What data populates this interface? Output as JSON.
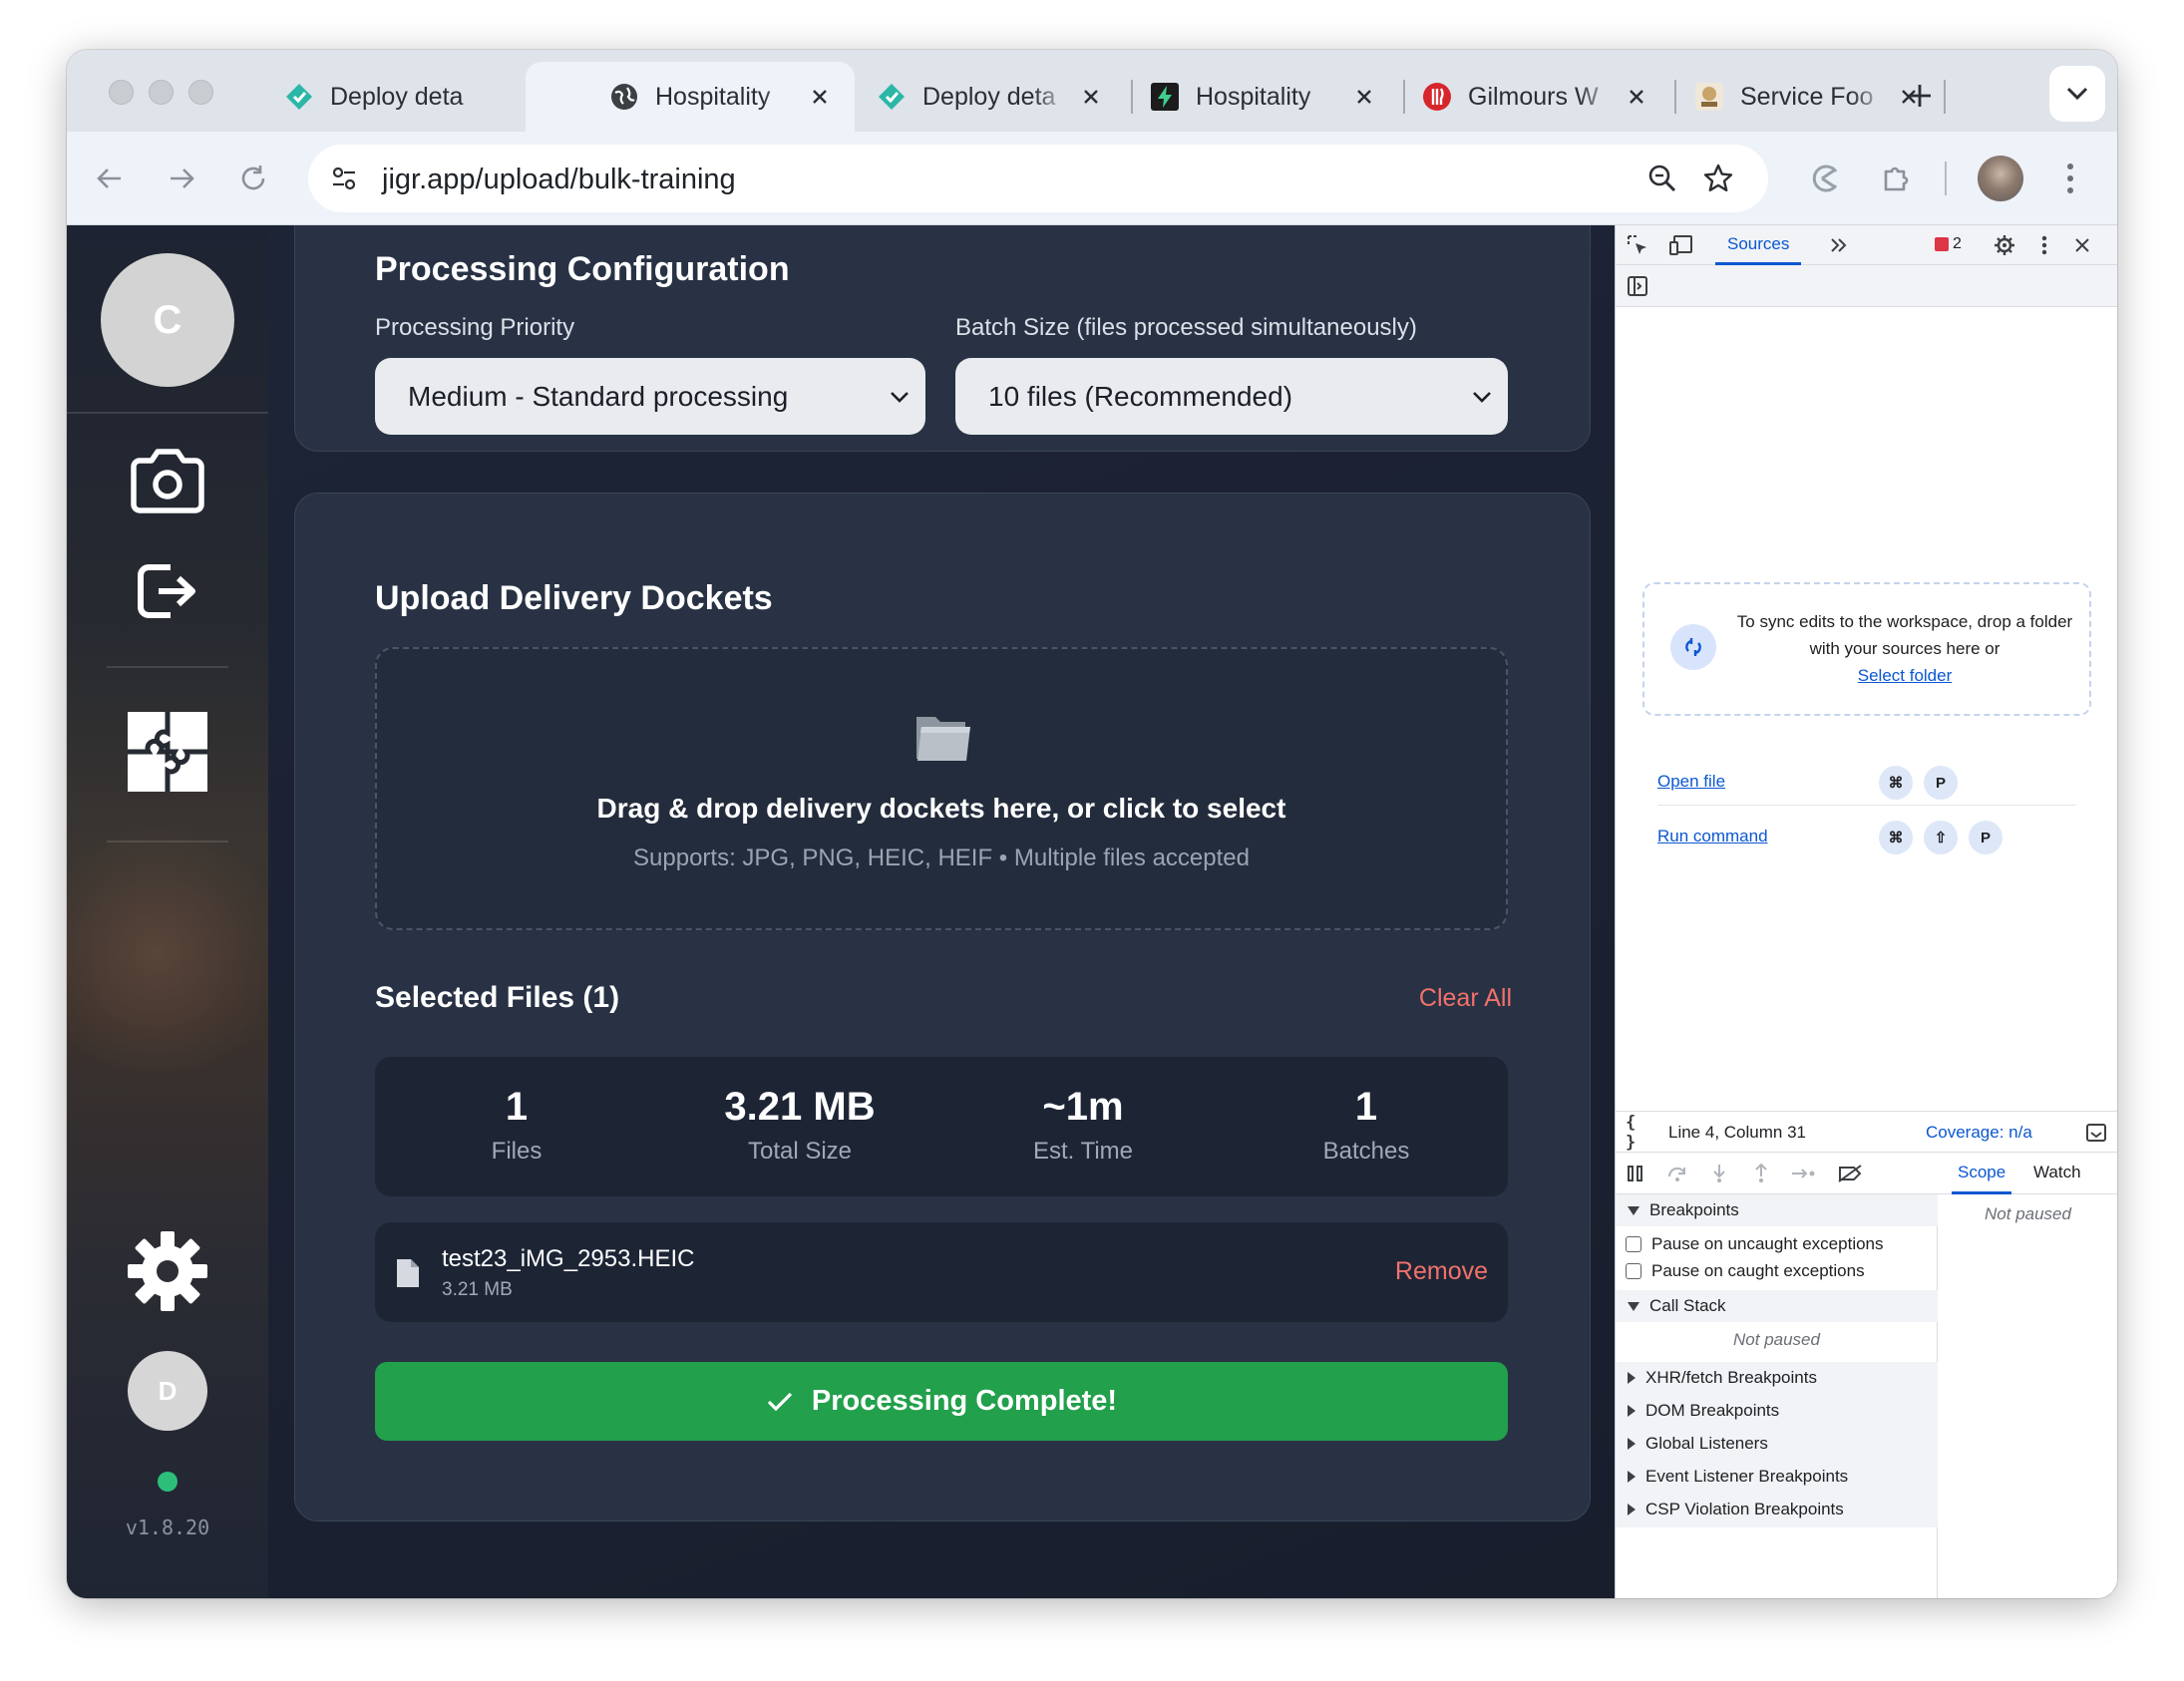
{
  "browser": {
    "tabs": [
      {
        "title": "Deploy deta",
        "favicon": "netlify-diamond-icon",
        "active": false
      },
      {
        "title": "Hospitality",
        "favicon": "globe-icon",
        "active": true
      },
      {
        "title": "Deploy deta",
        "favicon": "netlify-diamond-icon",
        "active": false
      },
      {
        "title": "Hospitality",
        "favicon": "supabase-bolt-icon",
        "active": false
      },
      {
        "title": "Gilmours W",
        "favicon": "gilmours-logo-icon",
        "active": false
      },
      {
        "title": "Service Foo",
        "favicon": "service-foods-logo-icon",
        "active": false
      }
    ],
    "url": "jigr.app/upload/bulk-training"
  },
  "sidebar": {
    "top_avatar": "C",
    "user_avatar": "D",
    "version": "v1.8.20",
    "status_color": "#2bbf7a"
  },
  "processing_config": {
    "title": "Processing Configuration",
    "priority_label": "Processing Priority",
    "priority_value": "Medium - Standard processing",
    "batch_label": "Batch Size (files processed simultaneously)",
    "batch_value": "10 files (Recommended)"
  },
  "upload": {
    "title": "Upload Delivery Dockets",
    "dropzone_title": "Drag & drop delivery dockets here, or click to select",
    "dropzone_sub": "Supports: JPG, PNG, HEIC, HEIF • Multiple files accepted",
    "selected_title": "Selected Files (1)",
    "clear_all": "Clear All",
    "stats": [
      {
        "value": "1",
        "label": "Files"
      },
      {
        "value": "3.21 MB",
        "label": "Total Size"
      },
      {
        "value": "~1m",
        "label": "Est. Time"
      },
      {
        "value": "1",
        "label": "Batches"
      }
    ],
    "file": {
      "name": "test23_iMG_2953.HEIC",
      "size": "3.21 MB",
      "remove": "Remove"
    },
    "complete_button": "Processing Complete!",
    "accent_green": "#22a04b",
    "danger_color": "#f2716b"
  },
  "devtools": {
    "active_tab": "Sources",
    "error_count": "2",
    "sync_text": "To sync edits to the workspace, drop a folder with your sources here or",
    "select_folder": "Select folder",
    "open_file": "Open file",
    "run_command": "Run command",
    "keys": {
      "cmd": "⌘",
      "shift": "⇧",
      "p": "P"
    },
    "position": "Line 4, Column 31",
    "coverage": "Coverage: n/a",
    "scope_tab": "Scope",
    "watch_tab": "Watch",
    "not_paused": "Not paused",
    "breakpoints": "Breakpoints",
    "pause_uncaught": "Pause on uncaught exceptions",
    "pause_caught": "Pause on caught exceptions",
    "call_stack": "Call Stack",
    "sections": [
      "XHR/fetch Breakpoints",
      "DOM Breakpoints",
      "Global Listeners",
      "Event Listener Breakpoints",
      "CSP Violation Breakpoints"
    ]
  }
}
